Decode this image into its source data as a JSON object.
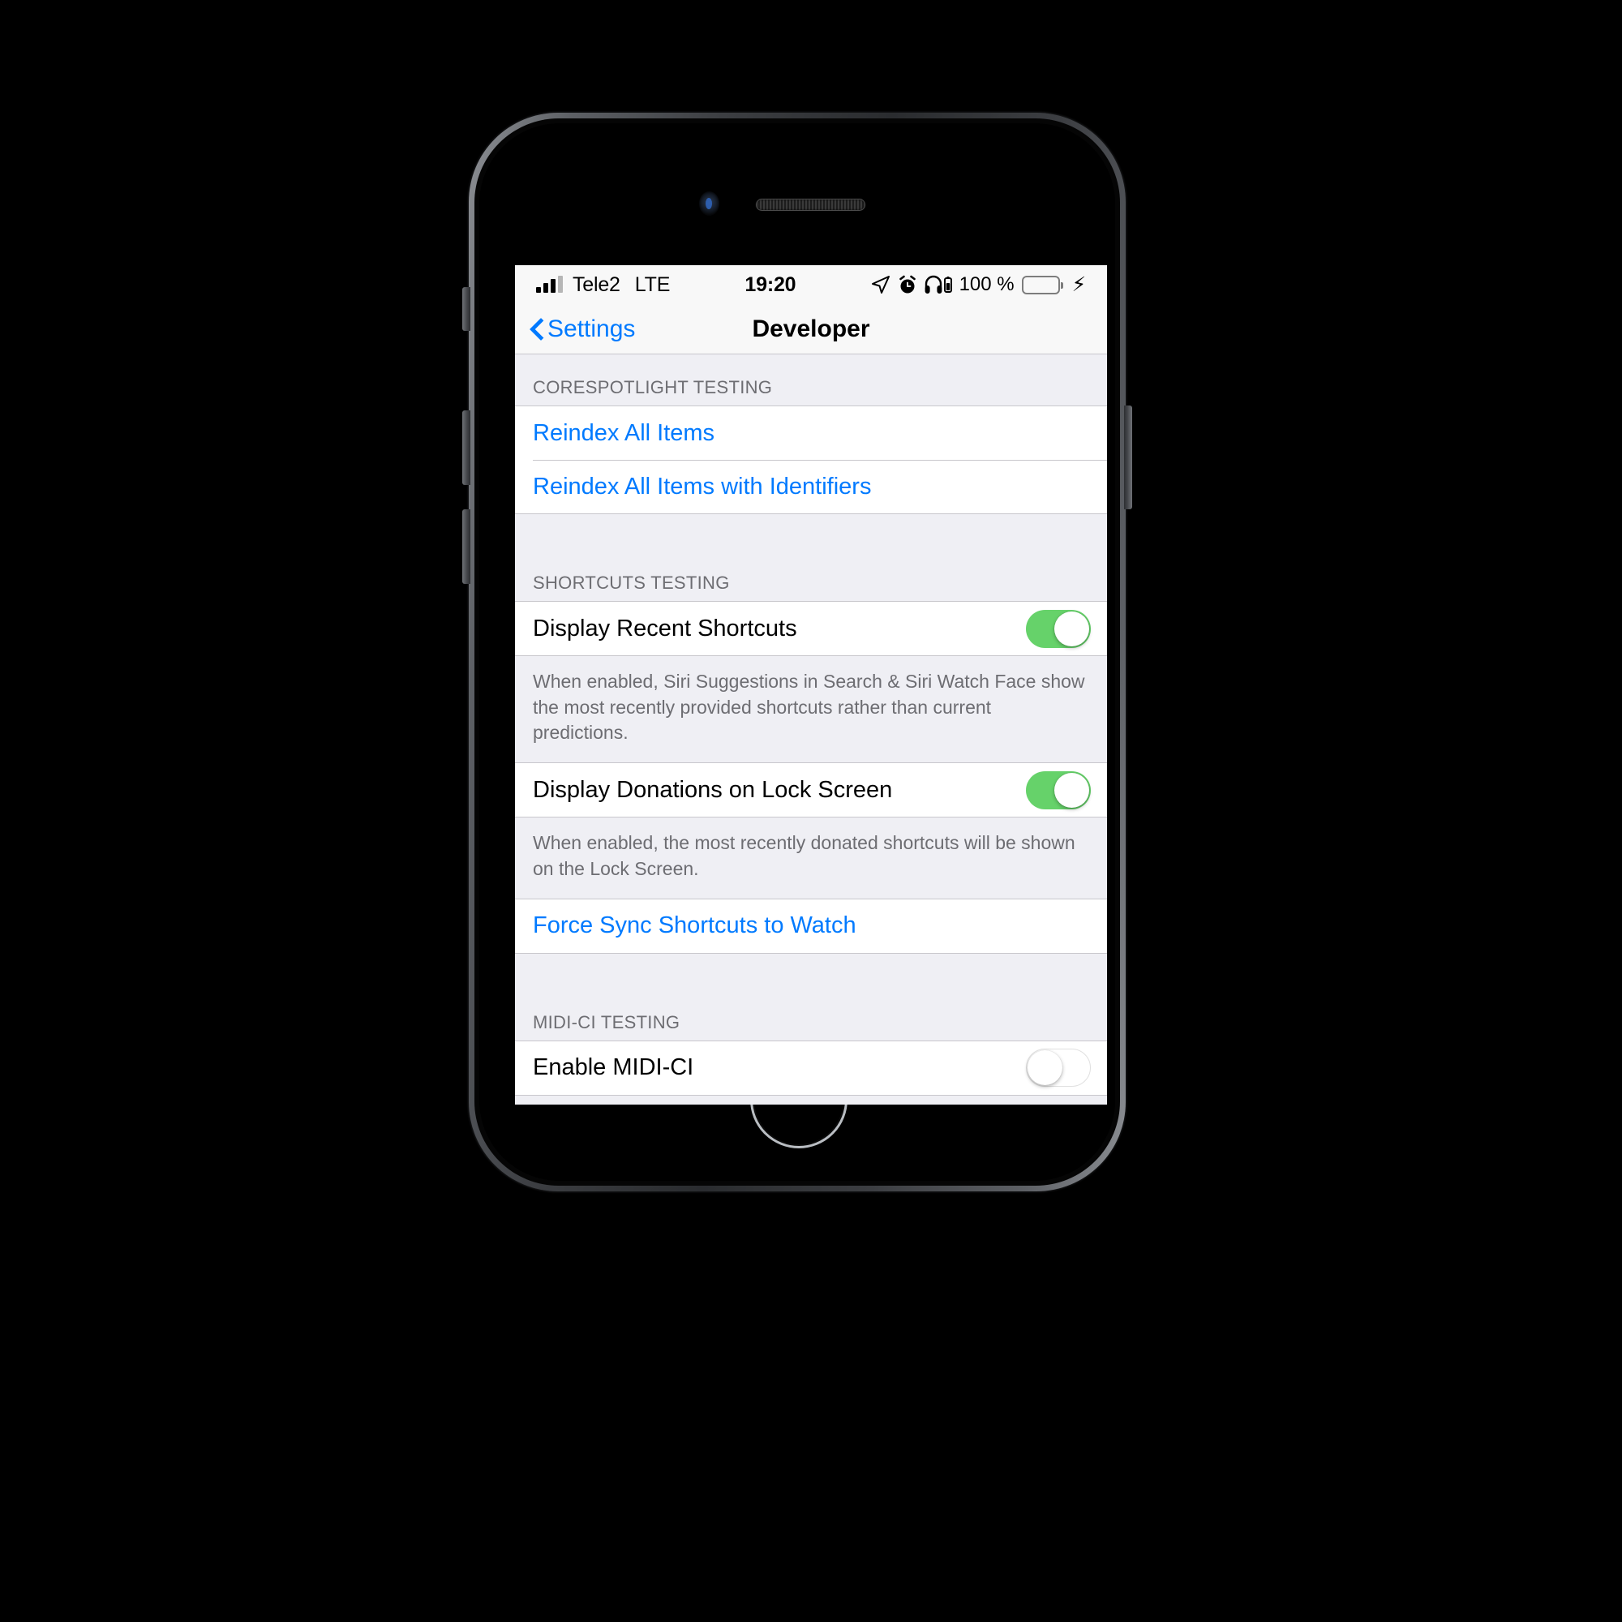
{
  "device": {
    "frame": "iphone-8-space-gray",
    "accent_color": "#007aff",
    "switch_on_color": "#66d26a",
    "group_bg_color": "#efeff4"
  },
  "status_bar": {
    "signal_icon": "cellular-signal-icon",
    "carrier": "Tele2",
    "radio": "LTE",
    "time": "19:20",
    "location_icon": "location-arrow-icon",
    "alarm_icon": "alarm-clock-icon",
    "headphones_icon": "headphones-battery-icon",
    "battery_percent": "100 %",
    "battery_icon": "battery-full-icon",
    "charging_icon": "lightning-bolt-icon"
  },
  "nav_bar": {
    "back_label": "Settings",
    "back_icon": "chevron-left-icon",
    "title": "Developer"
  },
  "sections": [
    {
      "header": "CORESPOTLIGHT TESTING",
      "rows": [
        {
          "type": "link",
          "label": "Reindex All Items"
        },
        {
          "type": "link",
          "label": "Reindex All Items with Identifiers"
        }
      ],
      "footer": ""
    },
    {
      "header": "SHORTCUTS TESTING",
      "rows": [
        {
          "type": "switch",
          "label": "Display Recent Shortcuts",
          "value": "on"
        }
      ],
      "footer": "When enabled, Siri Suggestions in Search & Siri Watch Face show the most recently provided shortcuts rather than current predictions."
    },
    {
      "header": "",
      "rows": [
        {
          "type": "switch",
          "label": "Display Donations on Lock Screen",
          "value": "on"
        }
      ],
      "footer": "When enabled, the most recently donated shortcuts will be shown on the Lock Screen."
    },
    {
      "header": "",
      "rows": [
        {
          "type": "link",
          "label": "Force Sync Shortcuts to Watch"
        }
      ],
      "footer": ""
    },
    {
      "header": "MIDI-CI TESTING",
      "rows": [
        {
          "type": "switch",
          "label": "Enable MIDI-CI",
          "value": "off"
        }
      ],
      "footer": ""
    }
  ]
}
